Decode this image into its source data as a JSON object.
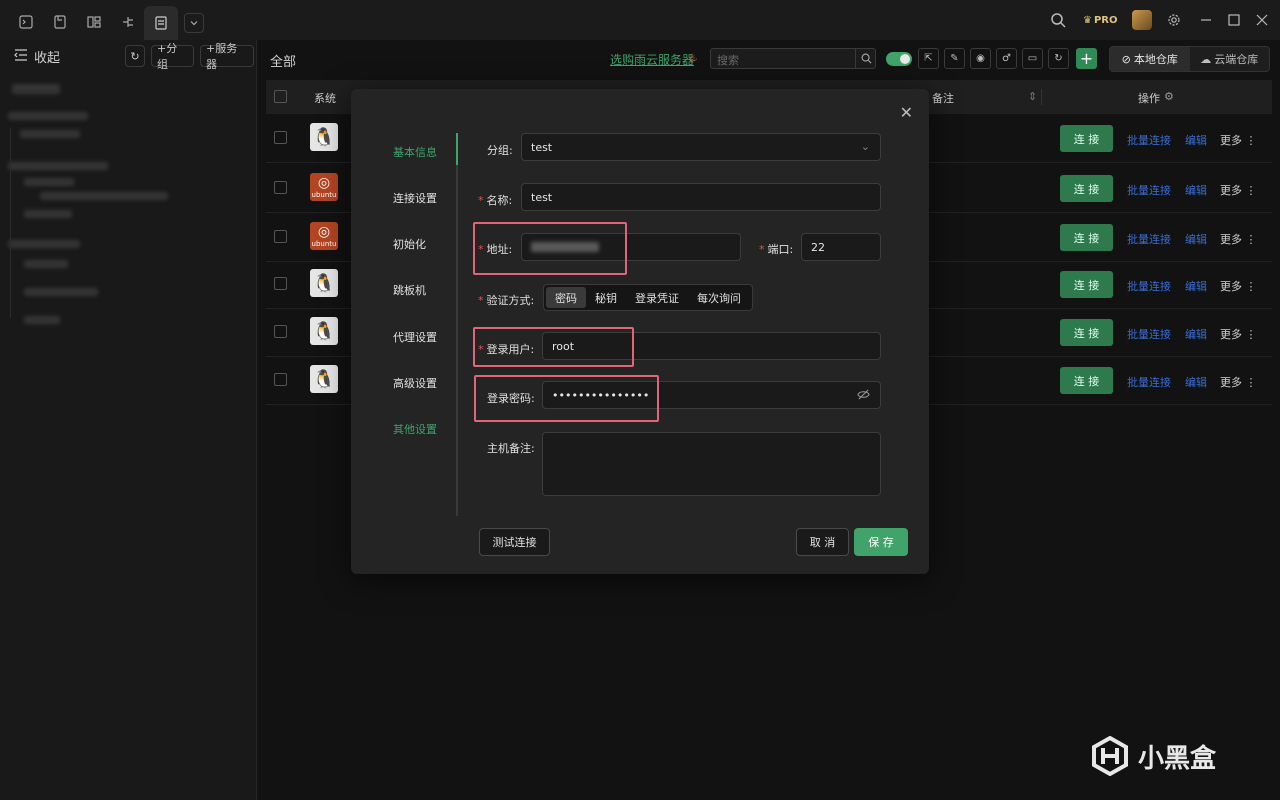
{
  "sidebar": {
    "collapse_label": "收起",
    "add_group_label": "+分组",
    "add_server_label": "+服务器"
  },
  "header": {
    "title": "全部",
    "promo_link": "选购雨云服务器",
    "search_placeholder": "搜索",
    "local_repo_label": "本地仓库",
    "cloud_repo_label": "云端仓库"
  },
  "table": {
    "columns": [
      "系统",
      "备注",
      "操作"
    ],
    "rows": [
      {
        "os": "linux",
        "connect": "连 接",
        "batch": "批量连接",
        "edit": "编辑",
        "more": "更多"
      },
      {
        "os": "ubuntu",
        "connect": "连 接",
        "batch": "批量连接",
        "edit": "编辑",
        "more": "更多"
      },
      {
        "os": "ubuntu",
        "connect": "连 接",
        "batch": "批量连接",
        "edit": "编辑",
        "more": "更多"
      },
      {
        "os": "linux",
        "connect": "连 接",
        "batch": "批量连接",
        "edit": "编辑",
        "more": "更多"
      },
      {
        "os": "linux",
        "connect": "连 接",
        "batch": "批量连接",
        "edit": "编辑",
        "more": "更多"
      },
      {
        "os": "linux",
        "connect": "连 接",
        "batch": "批量连接",
        "edit": "编辑",
        "more": "更多"
      }
    ],
    "ubuntu_label": "ubuntu"
  },
  "modal": {
    "nav": [
      "基本信息",
      "连接设置",
      "初始化",
      "跳板机",
      "代理设置",
      "高级设置",
      "其他设置"
    ],
    "group_label": "分组:",
    "group_value": "test",
    "name_label": "名称:",
    "name_value": "test",
    "address_label": "地址:",
    "port_label": "端口:",
    "port_value": "22",
    "auth_label": "验证方式:",
    "auth_options": [
      "密码",
      "秘钥",
      "登录凭证",
      "每次询问"
    ],
    "user_label": "登录用户:",
    "user_value": "root",
    "password_label": "登录密码:",
    "password_value": "•••••••••••••••",
    "notes_label": "主机备注:",
    "test_button": "测试连接",
    "cancel_button": "取 消",
    "save_button": "保 存"
  },
  "watermark": {
    "text": "小黑盒"
  },
  "colors": {
    "accent": "#3fa36a",
    "link": "#3a6dcf",
    "highlight": "#e06677"
  }
}
